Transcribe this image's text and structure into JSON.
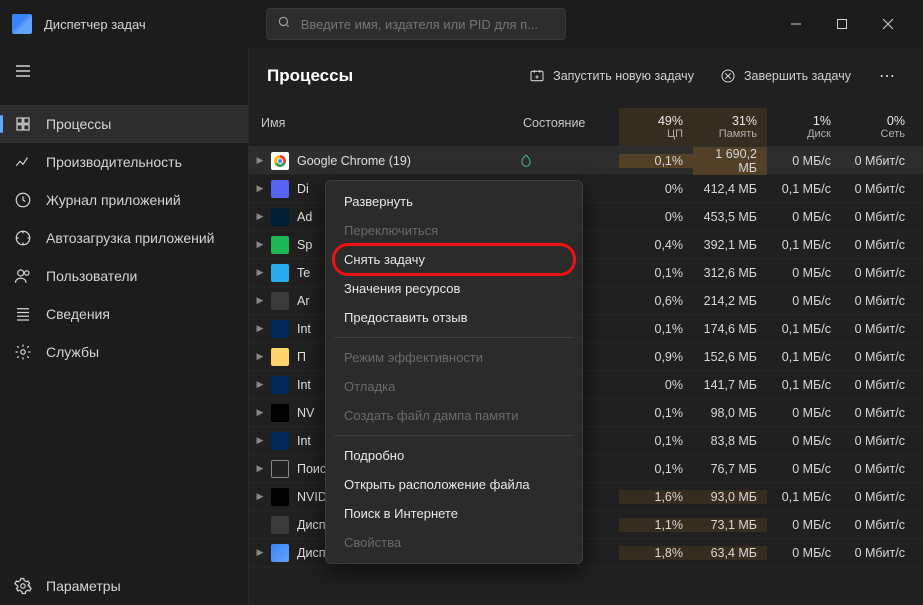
{
  "titlebar": {
    "title": "Диспетчер задач"
  },
  "search": {
    "placeholder": "Введите имя, издателя или PID для п..."
  },
  "sidebar": {
    "items": [
      {
        "label": "Процессы"
      },
      {
        "label": "Производительность"
      },
      {
        "label": "Журнал приложений"
      },
      {
        "label": "Автозагрузка приложений"
      },
      {
        "label": "Пользователи"
      },
      {
        "label": "Сведения"
      },
      {
        "label": "Службы"
      }
    ],
    "settings": "Параметры"
  },
  "page": {
    "title": "Процессы",
    "run_new": "Запустить новую задачу",
    "end_task": "Завершить задачу"
  },
  "columns": {
    "name": "Имя",
    "status": "Состояние",
    "cpu": {
      "value": "49%",
      "label": "ЦП"
    },
    "mem": {
      "value": "31%",
      "label": "Память"
    },
    "disk": {
      "value": "1%",
      "label": "Диск"
    },
    "net": {
      "value": "0%",
      "label": "Сеть"
    }
  },
  "rows": [
    {
      "name": "Google Chrome (19)",
      "icon": "chrome",
      "expand": true,
      "status": "eco",
      "cpu": "0,1%",
      "mem": "1 690,2 МБ",
      "disk": "0 МБ/с",
      "net": "0 Мбит/с",
      "selected": true,
      "heat": 2
    },
    {
      "name": "Di",
      "icon": "discord",
      "expand": true,
      "cpu": "0%",
      "mem": "412,4 МБ",
      "disk": "0,1 МБ/с",
      "net": "0 Мбит/с"
    },
    {
      "name": "Ad",
      "icon": "ps",
      "expand": true,
      "cpu": "0%",
      "mem": "453,5 МБ",
      "disk": "0 МБ/с",
      "net": "0 Мбит/с"
    },
    {
      "name": "Sp",
      "icon": "spotify",
      "expand": true,
      "cpu": "0,4%",
      "mem": "392,1 МБ",
      "disk": "0,1 МБ/с",
      "net": "0 Мбит/с"
    },
    {
      "name": "Te",
      "icon": "telegram",
      "expand": true,
      "cpu": "0,1%",
      "mem": "312,6 МБ",
      "disk": "0 МБ/с",
      "net": "0 Мбит/с"
    },
    {
      "name": "Ar",
      "icon": "default",
      "expand": true,
      "cpu": "0,6%",
      "mem": "214,2 МБ",
      "disk": "0 МБ/с",
      "net": "0 Мбит/с"
    },
    {
      "name": "Int",
      "icon": "intel",
      "expand": true,
      "cpu": "0,1%",
      "mem": "174,6 МБ",
      "disk": "0,1 МБ/с",
      "net": "0 Мбит/с"
    },
    {
      "name": "П",
      "icon": "explorer",
      "expand": true,
      "cpu": "0,9%",
      "mem": "152,6 МБ",
      "disk": "0,1 МБ/с",
      "net": "0 Мбит/с"
    },
    {
      "name": "Int",
      "icon": "intel",
      "expand": true,
      "cpu": "0%",
      "mem": "141,7 МБ",
      "disk": "0,1 МБ/с",
      "net": "0 Мбит/с"
    },
    {
      "name": "NV",
      "icon": "nvidia",
      "expand": true,
      "cpu": "0,1%",
      "mem": "98,0 МБ",
      "disk": "0 МБ/с",
      "net": "0 Мбит/с"
    },
    {
      "name": "Int",
      "icon": "intel",
      "expand": true,
      "cpu": "0,1%",
      "mem": "83,8 МБ",
      "disk": "0 МБ/с",
      "net": "0 Мбит/с"
    },
    {
      "name": "Поиск (3)",
      "icon": "search",
      "expand": true,
      "status": "pause",
      "cpu": "0,1%",
      "mem": "76,7 МБ",
      "disk": "0 МБ/с",
      "net": "0 Мбит/с"
    },
    {
      "name": "NVIDIA Container (4)",
      "icon": "nvidia",
      "expand": true,
      "cpu": "1,6%",
      "mem": "93,0 МБ",
      "disk": "0,1 МБ/с",
      "net": "0 Мбит/с",
      "heat": 1
    },
    {
      "name": "Диспетчер окон рабочего ст...",
      "icon": "default",
      "expand": false,
      "cpu": "1,1%",
      "mem": "73,1 МБ",
      "disk": "0 МБ/с",
      "net": "0 Мбит/с",
      "heat": 1
    },
    {
      "name": "Диспетчер задач",
      "icon": "tm",
      "expand": true,
      "cpu": "1,8%",
      "mem": "63,4 МБ",
      "disk": "0 МБ/с",
      "net": "0 Мбит/с",
      "heat": 1
    }
  ],
  "context_menu": [
    {
      "label": "Развернуть",
      "type": "item"
    },
    {
      "label": "Переключиться",
      "type": "item",
      "disabled": true
    },
    {
      "label": "Снять задачу",
      "type": "item",
      "highlight": true
    },
    {
      "label": "Значения ресурсов",
      "type": "item"
    },
    {
      "label": "Предоставить отзыв",
      "type": "item"
    },
    {
      "type": "sep"
    },
    {
      "label": "Режим эффективности",
      "type": "item",
      "disabled": true
    },
    {
      "label": "Отладка",
      "type": "item",
      "disabled": true
    },
    {
      "label": "Создать файл дампа памяти",
      "type": "item",
      "disabled": true
    },
    {
      "type": "sep"
    },
    {
      "label": "Подробно",
      "type": "item"
    },
    {
      "label": "Открыть расположение файла",
      "type": "item"
    },
    {
      "label": "Поиск в Интернете",
      "type": "item"
    },
    {
      "label": "Свойства",
      "type": "item",
      "disabled": true
    }
  ]
}
